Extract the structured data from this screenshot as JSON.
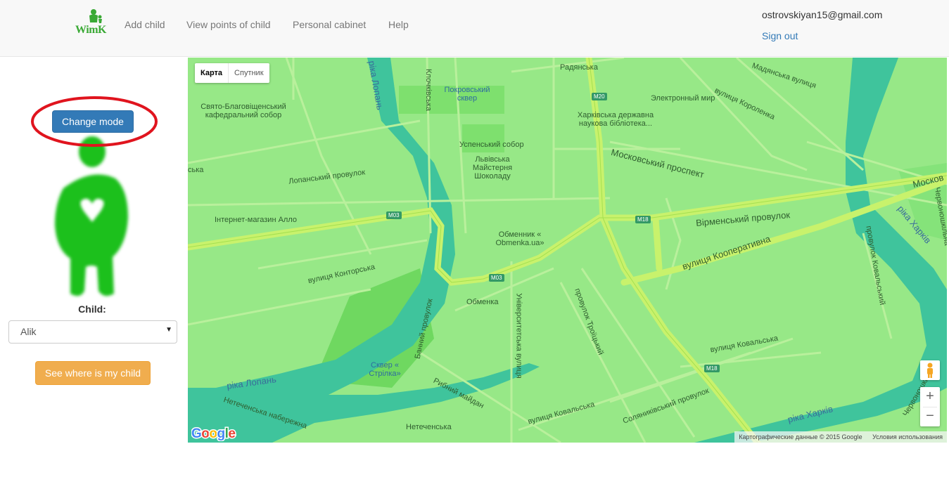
{
  "navbar": {
    "brand": "WimK",
    "links": [
      "Add child",
      "View points of child",
      "Personal cabinet",
      "Help"
    ],
    "user_email": "ostrovskiyan15@gmail.com",
    "sign_out": "Sign out"
  },
  "sidebar": {
    "change_mode": "Change mode",
    "child_label": "Child:",
    "child_selected": "Alik",
    "see_button": "See where is my child"
  },
  "colors": {
    "primary": "#337ab7",
    "warning": "#f0ad4e",
    "brand_green": "#3aa935",
    "figure_green": "#1ec01e",
    "highlight_red": "#e0141e",
    "map_land": "#97e887",
    "map_water": "#3fc49c",
    "map_road": "#c8f26c"
  },
  "map": {
    "type_controls": [
      "Карта",
      "Спутник"
    ],
    "attribution": "Картографические данные © 2015 Google",
    "terms": "Условия использования",
    "zoom_in": "+",
    "zoom_out": "−",
    "labels": {
      "radianska": "Радянська",
      "pokrovsky": "Покровський сквер",
      "electronny": "Электронный мир",
      "blagovishch": "Свято-Благовіщенський кафедральний собор",
      "biblioteka": "Харківська державна наукова бібліотека...",
      "uspensky": "Успенський собор",
      "lvivska": "Львівська Майстерня Шоколаду",
      "lopansky_pr": "Лопанський провулок",
      "allo": "Інтернет-магазин Алло",
      "obmennik": "Обменник « Obmenka.ua»",
      "kontorska": "вулиця Конторська",
      "obmenka": "Обменка",
      "banny": "Банний провулок",
      "skver": "Сквер « Стрілка»",
      "rybny": "Рибний майдан",
      "netechenska_nab": "Нетеченська набережна",
      "netechenska": "Нетеченська",
      "kovalska_bottom": "вулиця Ковальська",
      "soliannykivsky": "Соляниківський провулок",
      "troitsky": "провулок Троїцький",
      "universytetska": "Університетська вулиця",
      "vulytsia_kovalska": "вулиця Ковальська",
      "kooperatyvna": "вулиця Кооперативна",
      "virmensky": "Вірменський провулок",
      "moskovsky": "Московський проспект",
      "korolenka": "вулиця Короленка",
      "kvitky": "Клочківська",
      "madyanska": "Мадянська вулиця",
      "kovalsky_pr": "провулок Ковальський",
      "chervonoshk": "Червоношкільна",
      "chervonoshk2": "Червоношкільн",
      "moskov_edge": "Москов",
      "riska": "ська"
    },
    "rivers": {
      "lopan": "ріка Лопань",
      "lopan_v": "ріка Лопань",
      "kharkiv": "ріка Харків",
      "kharkiv2": "ріка Харків"
    },
    "shields": {
      "m03a": "M03",
      "m03b": "M03",
      "m18a": "M18",
      "m18b": "M18",
      "m20": "M20"
    }
  }
}
